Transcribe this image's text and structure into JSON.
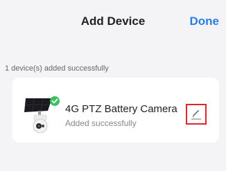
{
  "header": {
    "title": "Add Device",
    "done_label": "Done"
  },
  "status": {
    "message": "1 device(s) added successfully"
  },
  "device": {
    "name": "4G PTZ Battery Camera",
    "status_text": "Added successfully",
    "thumbnail_icon": "solar-ptz-camera-icon",
    "check_icon": "check-badge-icon",
    "edit_icon": "pencil-edit-icon"
  },
  "colors": {
    "accent": "#2a7de1",
    "success": "#3cc060",
    "highlight_border": "#e0242a",
    "background": "#f4f4f6",
    "card": "#ffffff"
  }
}
